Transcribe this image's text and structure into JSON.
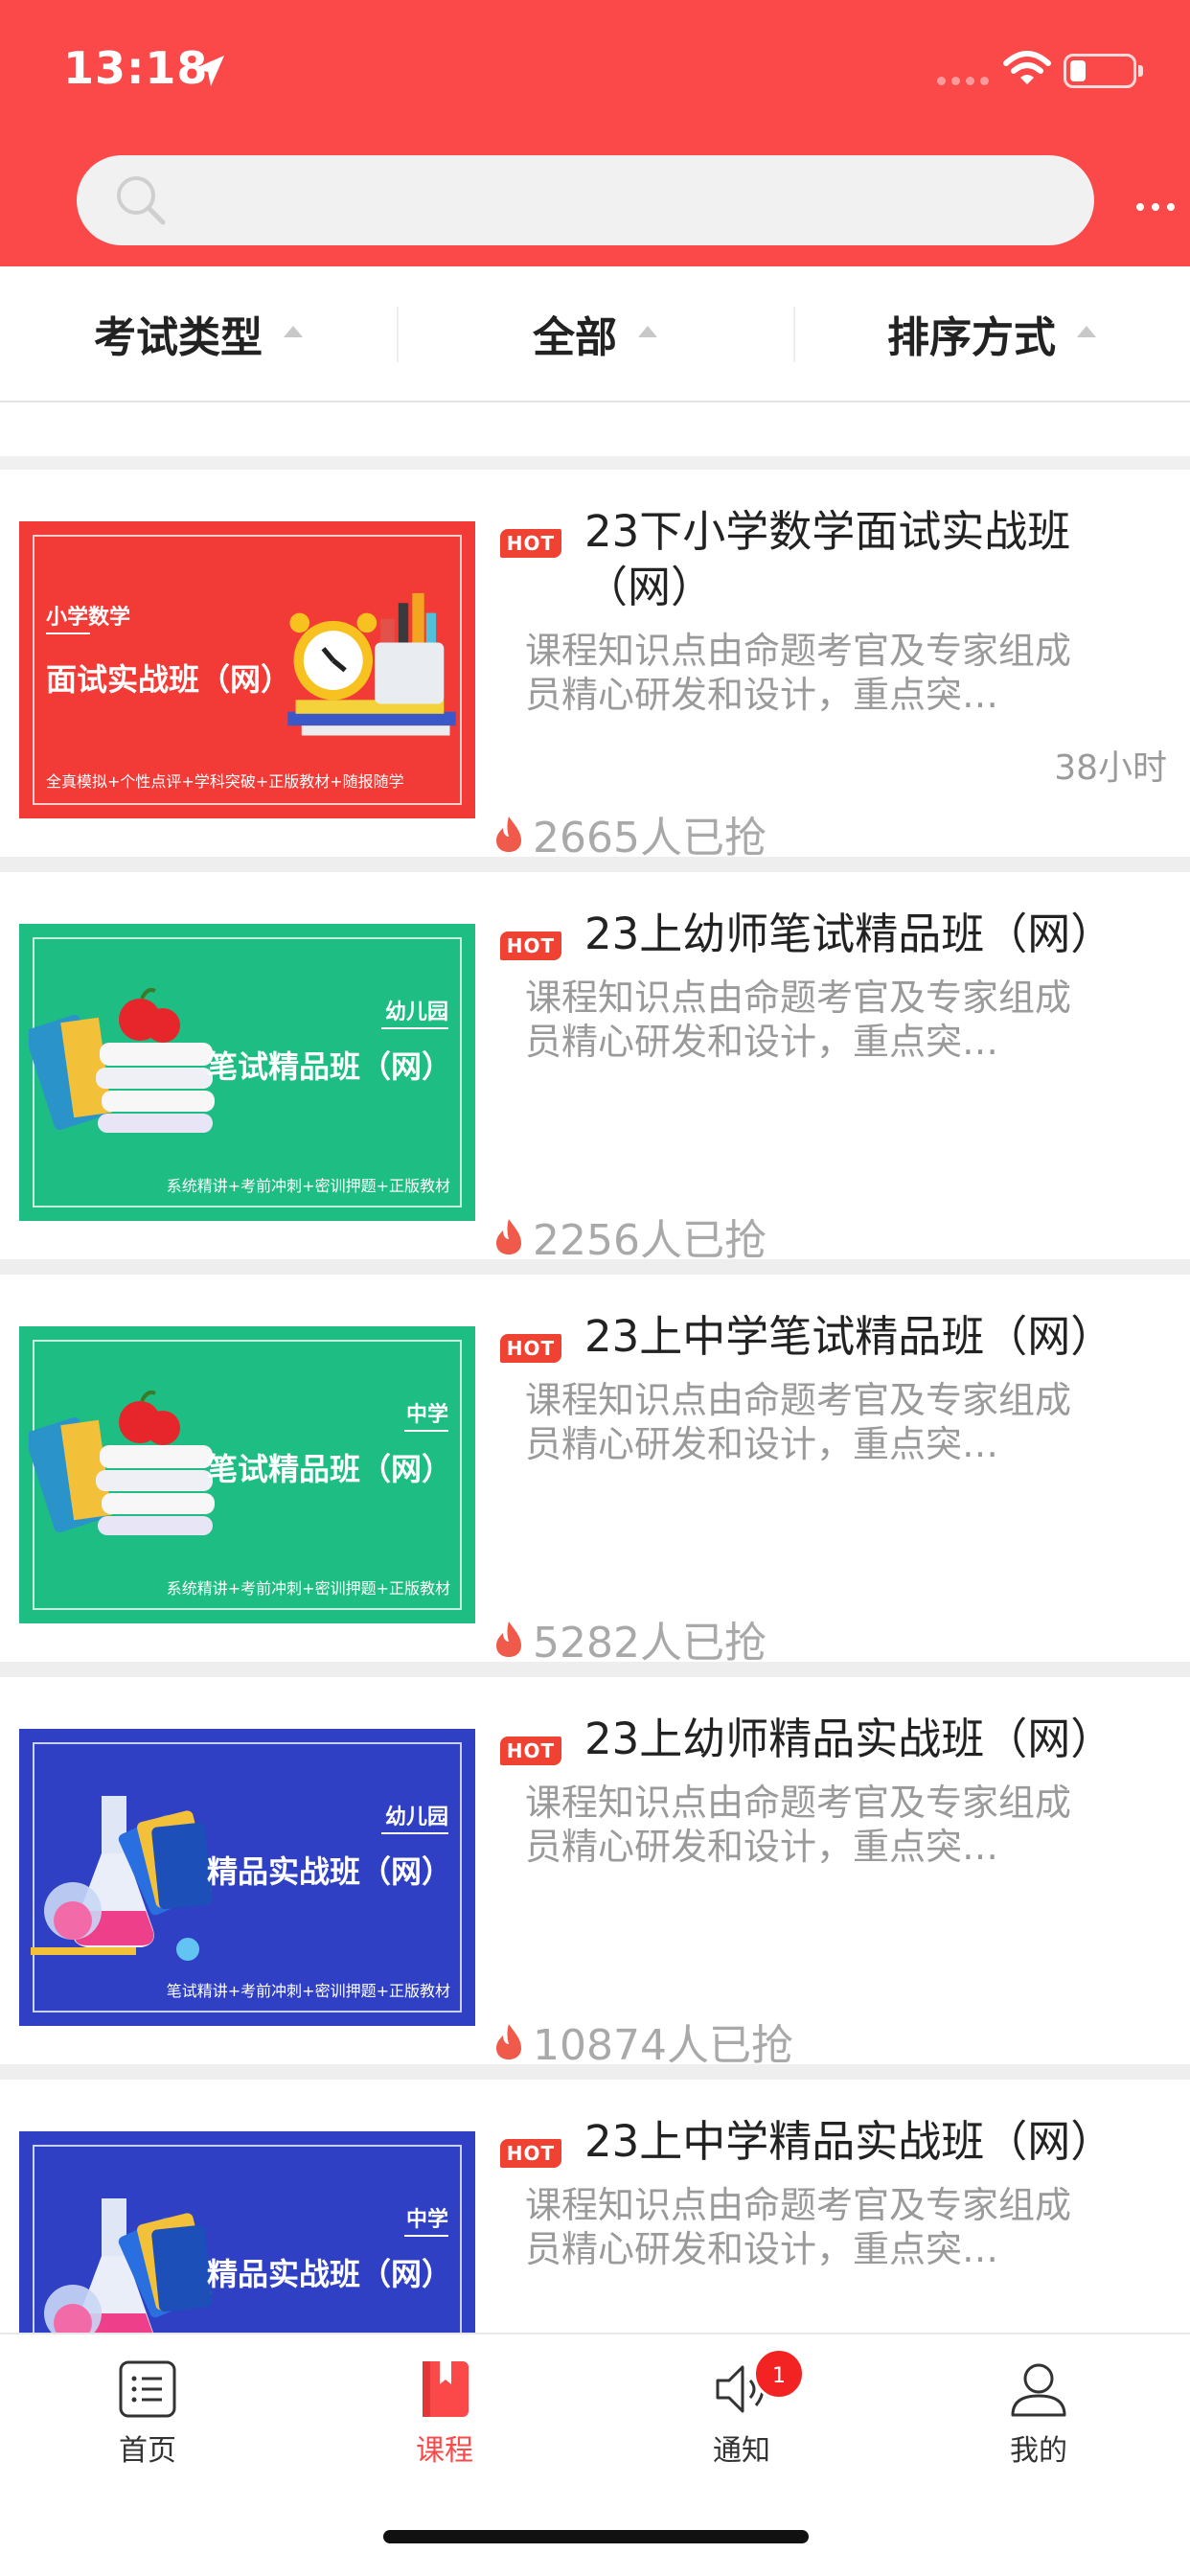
{
  "status": {
    "time": "13:18"
  },
  "search": {
    "placeholder": ""
  },
  "filters": [
    {
      "label": "考试类型"
    },
    {
      "label": "全部"
    },
    {
      "label": "排序方式"
    }
  ],
  "hot_label": "HOT",
  "courses": [
    {
      "title": "23下小学数学面试实战班（网）",
      "desc": "课程知识点由命题考官及专家组成员精心研发和设计，重点突…",
      "hours": "38小时",
      "sold": "2665人已抢",
      "thumb": {
        "sub": "小学数学",
        "title": "面试实战班（网）",
        "tag": "全真模拟+个性点评+学科突破+正版教材+随报随学",
        "color": "#f23a36"
      }
    },
    {
      "title": "23上幼师笔试精品班（网）",
      "desc": "课程知识点由命题考官及专家组成员精心研发和设计，重点突…",
      "hours": "",
      "sold": "2256人已抢",
      "thumb": {
        "sub": "幼儿园",
        "title": "笔试精品班（网）",
        "tag": "系统精讲+考前冲刺+密训押题+正版教材",
        "color": "#1ebd83"
      }
    },
    {
      "title": "23上中学笔试精品班（网）",
      "desc": "课程知识点由命题考官及专家组成员精心研发和设计，重点突…",
      "hours": "",
      "sold": "5282人已抢",
      "thumb": {
        "sub": "中学",
        "title": "笔试精品班（网）",
        "tag": "系统精讲+考前冲刺+密训押题+正版教材",
        "color": "#1ebd83"
      }
    },
    {
      "title": "23上幼师精品实战班（网）",
      "desc": "课程知识点由命题考官及专家组成员精心研发和设计，重点突…",
      "hours": "",
      "sold": "10874人已抢",
      "thumb": {
        "sub": "幼儿园",
        "title": "精品实战班（网）",
        "tag": "笔试精讲+考前冲刺+密训押题+正版教材",
        "color": "#2f40c4"
      }
    },
    {
      "title": "23上中学精品实战班（网）",
      "desc": "课程知识点由命题考官及专家组成员精心研发和设计，重点突…",
      "hours": "",
      "sold": "",
      "thumb": {
        "sub": "中学",
        "title": "精品实战班（网）",
        "tag": "",
        "color": "#2f40c4"
      }
    }
  ],
  "tabbar": {
    "home": "首页",
    "courses": "课程",
    "notify": "通知",
    "notify_badge": "1",
    "mine": "我的"
  },
  "colors": {
    "brand": "#fb4849",
    "hot": "#f04233",
    "green": "#1ebd83",
    "blue": "#2f40c4"
  }
}
